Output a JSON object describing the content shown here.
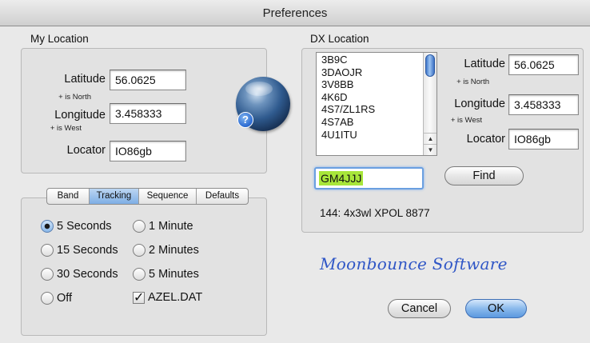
{
  "window": {
    "title": "Preferences"
  },
  "my_location": {
    "title": "My Location",
    "latitude_label": "Latitude",
    "latitude": "56.0625",
    "latitude_hint": "+ is North",
    "longitude_label": "Longitude",
    "longitude": "3.458333",
    "longitude_hint": "+ is West",
    "locator_label": "Locator",
    "locator": "IO86gb"
  },
  "tabs": [
    {
      "label": "Band",
      "selected": false
    },
    {
      "label": "Tracking",
      "selected": true
    },
    {
      "label": "Sequence",
      "selected": false
    },
    {
      "label": "Defaults",
      "selected": false
    }
  ],
  "tracking": {
    "options": [
      {
        "label": "5 Seconds",
        "selected": true
      },
      {
        "label": "1 Minute",
        "selected": false
      },
      {
        "label": "15 Seconds",
        "selected": false
      },
      {
        "label": "2 Minutes",
        "selected": false
      },
      {
        "label": "30 Seconds",
        "selected": false
      },
      {
        "label": "5 Minutes",
        "selected": false
      },
      {
        "label": "Off",
        "selected": false
      }
    ],
    "azel_checkbox": {
      "label": "AZEL.DAT",
      "checked": true
    }
  },
  "dx_location": {
    "title": "DX Location",
    "callsigns": [
      "3B9C",
      "3DAOJR",
      "3V8BB",
      "4K6D",
      "4S7/ZL1RS",
      "4S7AB",
      "4U1ITU"
    ],
    "latitude_label": "Latitude",
    "latitude": "56.0625",
    "latitude_hint": "+ is North",
    "longitude_label": "Longitude",
    "longitude": "3.458333",
    "longitude_hint": "+ is West",
    "locator_label": "Locator",
    "locator": "IO86gb",
    "search_value": "GM4JJJ",
    "find_label": "Find",
    "result_text": "144: 4x3wl XPOL  8877"
  },
  "brand": "Moonbounce Software",
  "buttons": {
    "cancel": "Cancel",
    "ok": "OK"
  },
  "colors": {
    "accent": "#5b98df",
    "highlight": "#a8e63a",
    "brand": "#2f56c6"
  },
  "icons": {
    "globe": "globe-help-icon",
    "checkmark": "checkmark-icon"
  }
}
